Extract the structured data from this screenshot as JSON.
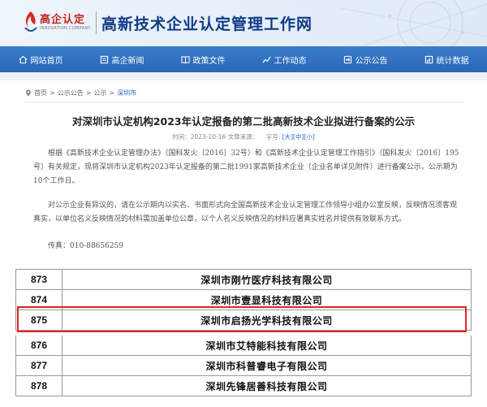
{
  "header": {
    "logo_text": "高企认定",
    "logo_sub": "INNOVATION COMPANY",
    "site_title": "高新技术企业认定管理工作网"
  },
  "nav": [
    {
      "label": "网站首页",
      "icon": "home-icon"
    },
    {
      "label": "高企新闻",
      "icon": "document-icon"
    },
    {
      "label": "政策文件",
      "icon": "book-icon"
    },
    {
      "label": "工作动态",
      "icon": "chart-icon"
    },
    {
      "label": "公示公告",
      "icon": "megaphone-icon"
    },
    {
      "label": "统计数据",
      "icon": "stats-icon"
    }
  ],
  "breadcrumb": {
    "items": [
      "首页",
      "公示公告",
      "公示"
    ],
    "active": "深圳市",
    "separator": ">"
  },
  "article": {
    "title": "对深圳市认定机构2023年认定报备的第二批高新技术企业拟进行备案的公示",
    "time_label": "时间：2023-10-16 文章来源：",
    "font_label": "字号:",
    "font_sizes": [
      "[大]",
      "[中]",
      "[小]"
    ],
    "paragraph1": "根据《高新技术企业认定管理办法》（国科发火〔2016〕32号）和《高新技术企业认定管理工作指引》（国科发火〔2016〕195号）有关规定，现将深圳市认定机构2023年认定报备的第二批1991家高新技术企业（企业名单详见附件）进行备案公示，公示期为10个工作日。",
    "paragraph2": "对公示企业有异议的，请在公示期内以实名、书面形式向全国高新技术企业认定管理工作领导小组办公室反映，反映情况须客观真实，以单位名义反映情况的材料需加盖单位公章，以个人名义反映情况的材料应署真实姓名并提供有效联系方式。",
    "paragraph3": "传真：010-88656259"
  },
  "table": {
    "rows": [
      {
        "num": "873",
        "name": "深圳市刚竹医疗科技有限公司"
      },
      {
        "num": "874",
        "name": "深圳市壹显科技有限公司"
      },
      {
        "num": "875",
        "name": "深圳市启扬光学科技有限公司"
      },
      {
        "num": "876",
        "name": "深圳市艾特能科技有限公司"
      },
      {
        "num": "877",
        "name": "深圳市科普睿电子有限公司"
      },
      {
        "num": "878",
        "name": "深圳先锋居善科技有限公司"
      }
    ],
    "highlighted_row": "875"
  },
  "colors": {
    "nav_bg": "#2d6fc0",
    "title_blue": "#0f3b85",
    "highlight_red": "#e02424",
    "logo_red": "#c8241f"
  }
}
